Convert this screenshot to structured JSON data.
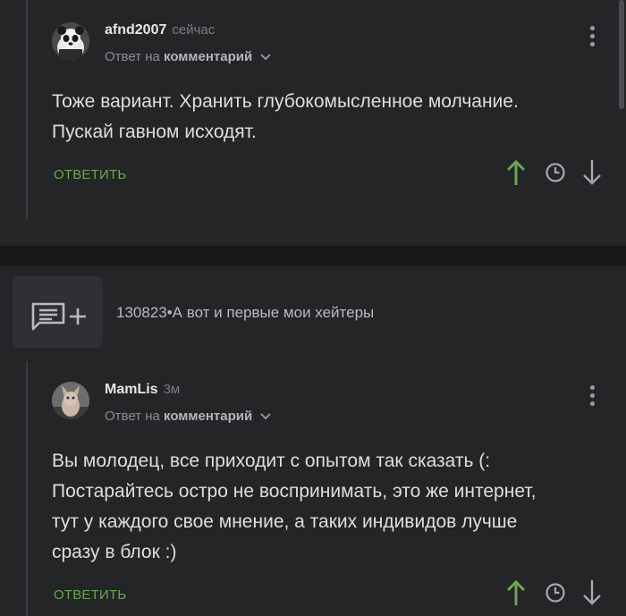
{
  "comments": [
    {
      "author": "afnd2007",
      "time": "сейчас",
      "reply_prefix": "Ответ на",
      "reply_target": "комментарий",
      "body": [
        "Тоже вариант. Хранить глубокомысленное молчание.",
        "Пускай гавном исходят."
      ],
      "reply_label": "ОТВЕТИТЬ"
    },
    {
      "author": "MamLis",
      "time": "3м",
      "reply_prefix": "Ответ на",
      "reply_target": "комментарий",
      "body": [
        "Вы молодец, все приходит с опытом так сказать (:",
        "Постарайтесь остро не воспринимать, это же интернет,",
        "тут у каждого свое мнение, а таких индивидов лучше",
        "сразу в блок :)"
      ],
      "reply_label": "ОТВЕТИТЬ"
    }
  ],
  "post": {
    "title": "130823•А вот и первые мои хейтеры"
  },
  "colors": {
    "background": "#232527",
    "accent_green": "#6ca650",
    "divider": "#161718"
  },
  "icons": [
    "upvote-arrow-icon",
    "clock-icon",
    "downvote-arrow-icon",
    "add-comment-icon",
    "more-vertical-icon",
    "chevron-down-icon"
  ]
}
